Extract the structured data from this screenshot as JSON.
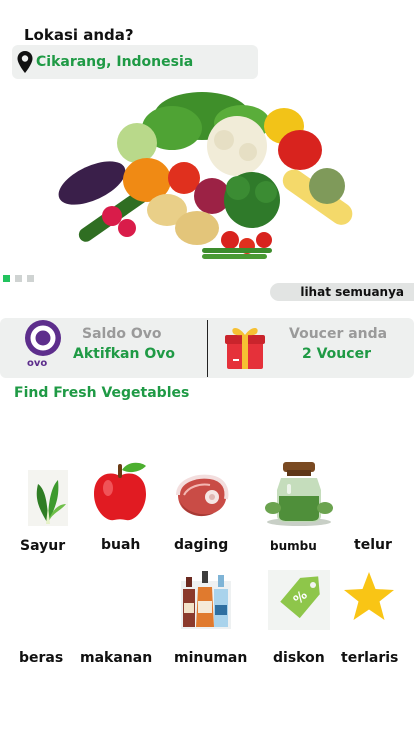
{
  "location": {
    "title": "Lokasi anda?",
    "value": "Cikarang, Indonesia"
  },
  "banner": {
    "icon": "vegetables-photo",
    "dots": [
      true,
      false,
      false
    ]
  },
  "see_all_label": "lihat semuanya",
  "wallet": {
    "ovo": {
      "logo_text": "ovo",
      "title": "Saldo Ovo",
      "action": "Aktifkan Ovo"
    },
    "voucher": {
      "title": "Voucer anda",
      "count": "2 Voucer"
    }
  },
  "section_title": "Find Fresh Vegetables",
  "categories": [
    {
      "label": "Sayur",
      "icon": "bok-choy-icon"
    },
    {
      "label": "buah",
      "icon": "apple-icon"
    },
    {
      "label": "daging",
      "icon": "steak-icon"
    },
    {
      "label": "bumbu",
      "icon": "spice-jar-icon"
    },
    {
      "label": "telur",
      "icon": ""
    },
    {
      "label": "beras",
      "icon": ""
    },
    {
      "label": "makanan",
      "icon": ""
    },
    {
      "label": "minuman",
      "icon": "bottles-icon"
    },
    {
      "label": "diskon",
      "icon": "discount-tag-icon"
    },
    {
      "label": "terlaris",
      "icon": "star-icon"
    }
  ],
  "colors": {
    "accent": "#1f9a45",
    "dot_active": "#22c35e",
    "panel_bg": "#eef0ef",
    "ovo_purple": "#5d2e8c"
  }
}
